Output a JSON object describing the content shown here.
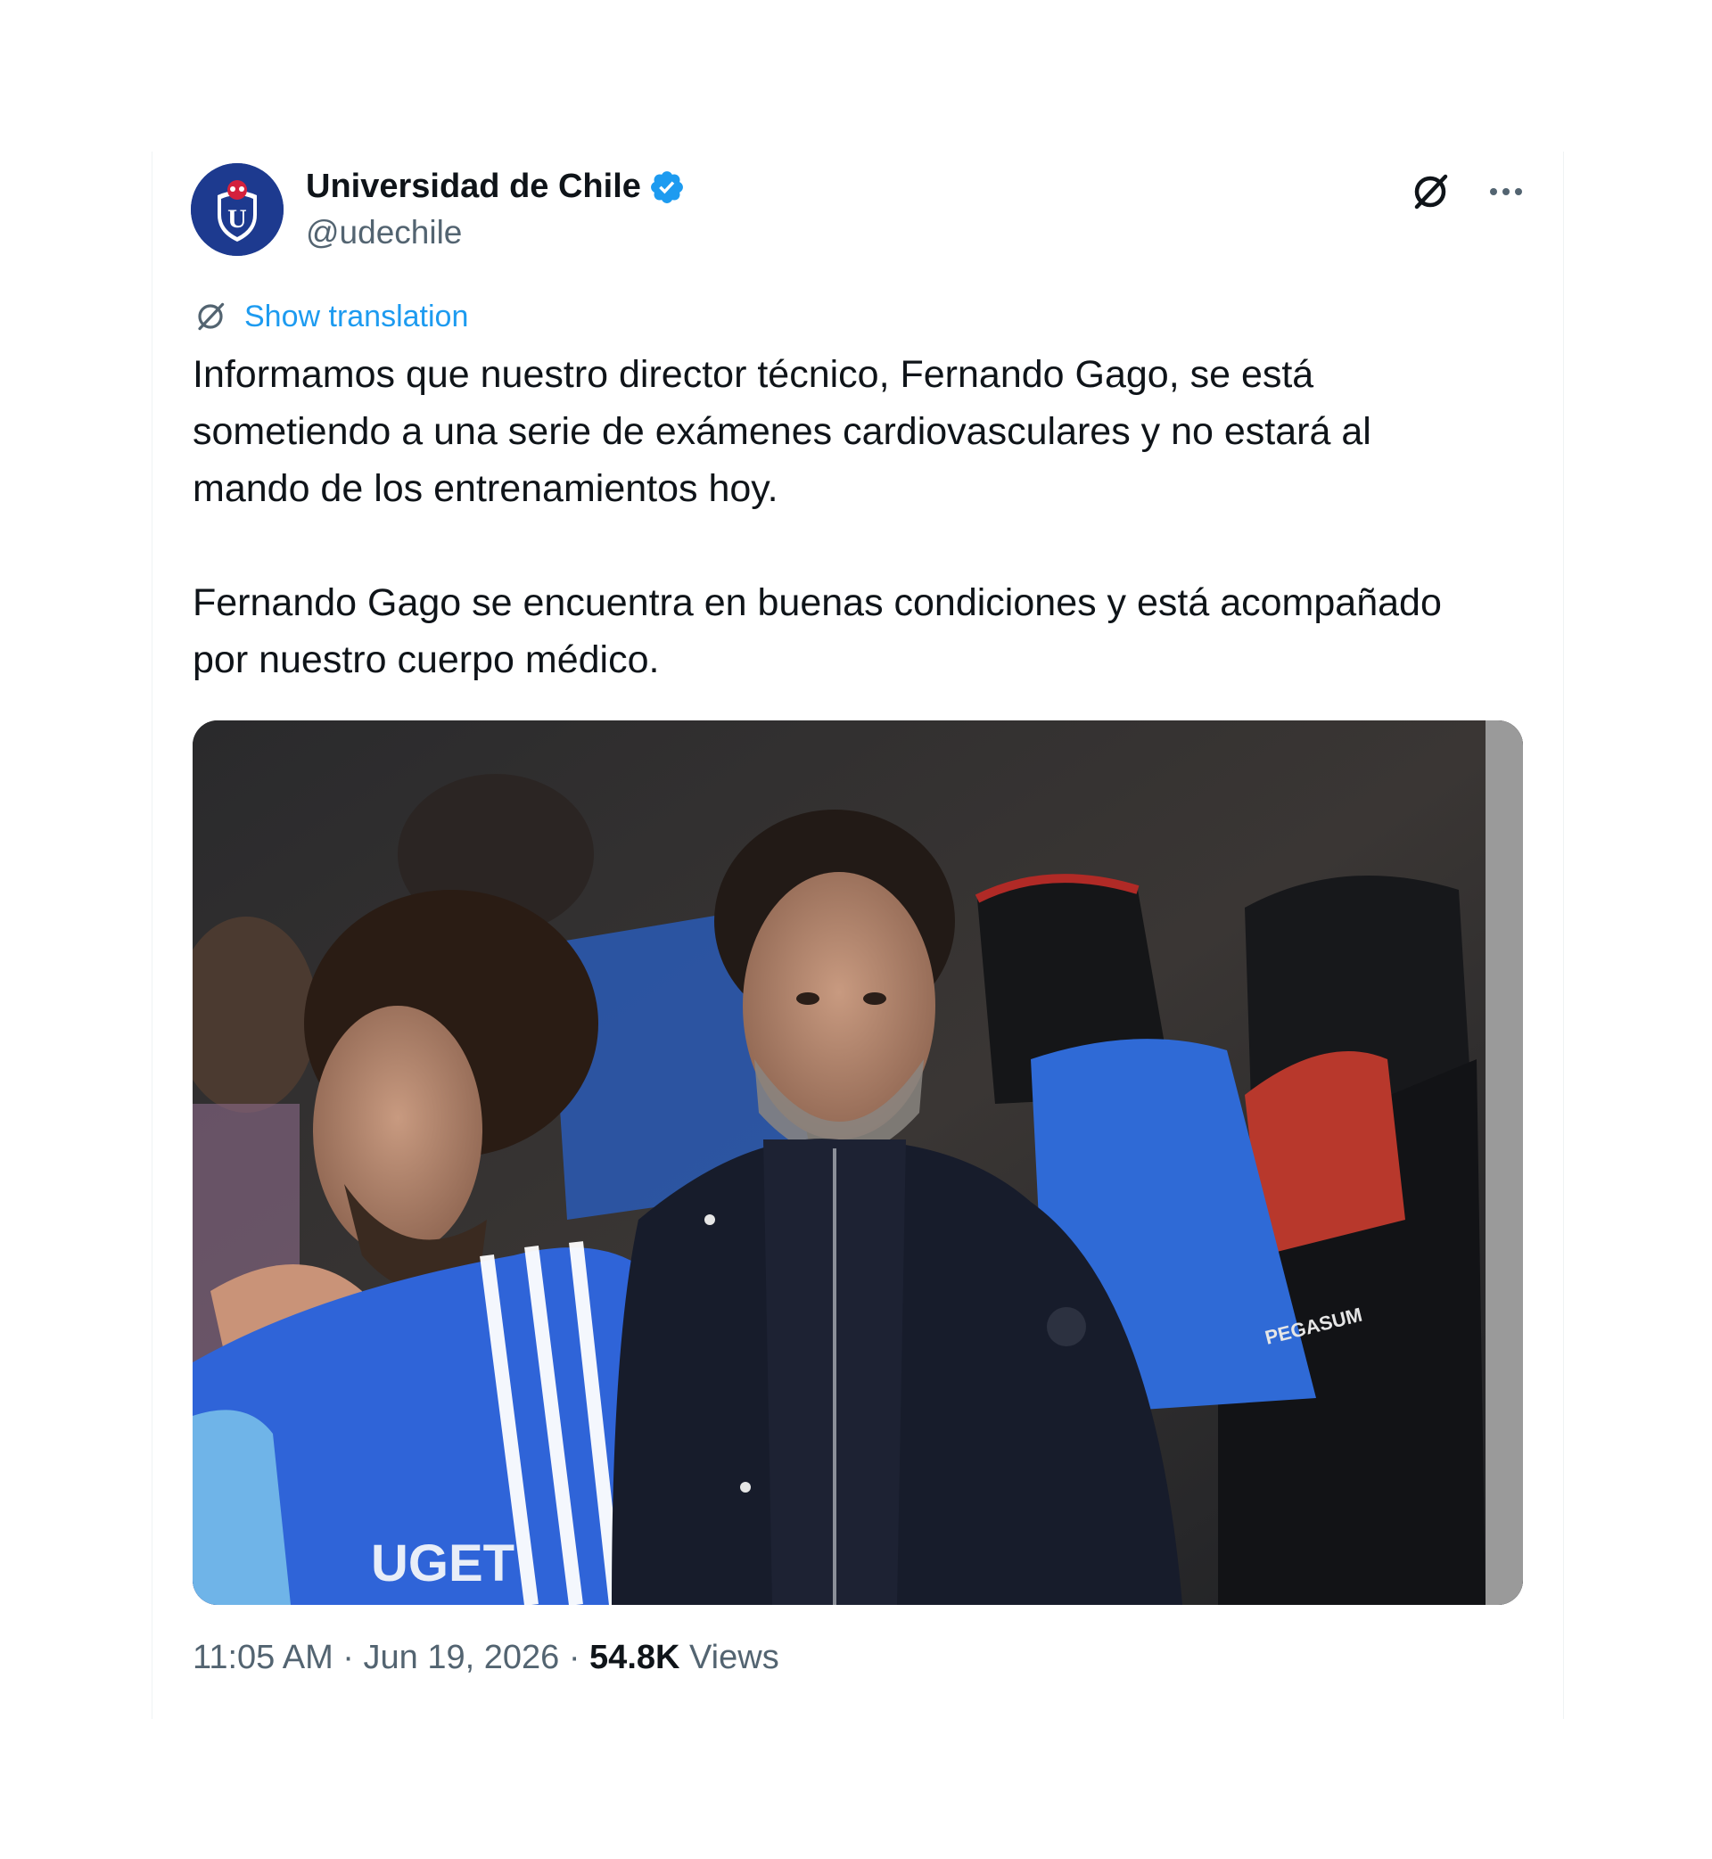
{
  "tweet": {
    "author": {
      "display_name": "Universidad de Chile",
      "handle": "@udechile",
      "verified": true,
      "avatar_icon": "udechile-crest-icon",
      "avatar_letter": "U"
    },
    "actions": {
      "grok_icon": "grok-icon",
      "more_icon": "more-options-icon"
    },
    "show_translation": "Show translation",
    "text_paragraphs": [
      "Informamos que nuestro director técnico, Fernando Gago, se está\nsometiendo a una serie de exámenes cardiovasculares y no estará al\nmando de los entrenamientos hoy.",
      "Fernando Gago se encuentra en buenas condiciones y está acompañado\npor nuestro cuerpo médico."
    ],
    "media": {
      "jersey_text": "UGET",
      "seat_brand": "PEGASUM"
    },
    "meta": {
      "time": "11:05 AM",
      "separator": " · ",
      "date": "Jun 19, 2026",
      "views_count": "54.8K",
      "views_label": " Views"
    }
  },
  "colors": {
    "link": "#1d9bf0",
    "verified": "#1d9bf0",
    "muted": "#536471",
    "text": "#0f1419",
    "brand_blue": "#1d3a8f"
  }
}
